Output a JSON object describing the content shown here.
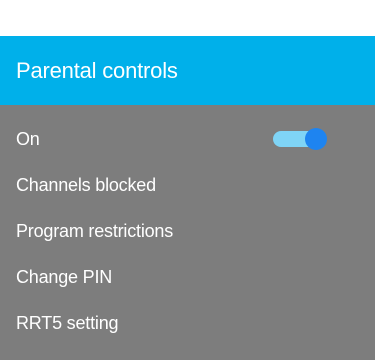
{
  "header": {
    "title": "Parental controls"
  },
  "menu": {
    "items": [
      {
        "label": "On",
        "toggle": {
          "state": "on"
        }
      },
      {
        "label": "Channels blocked"
      },
      {
        "label": "Program restrictions"
      },
      {
        "label": "Change PIN"
      },
      {
        "label": "RRT5 setting"
      }
    ]
  },
  "colors": {
    "header_bg": "#00b0ea",
    "panel_bg": "#7d7d7d",
    "toggle_track": "#7fd4f6",
    "toggle_thumb": "#1e84f0",
    "text": "#ffffff"
  }
}
